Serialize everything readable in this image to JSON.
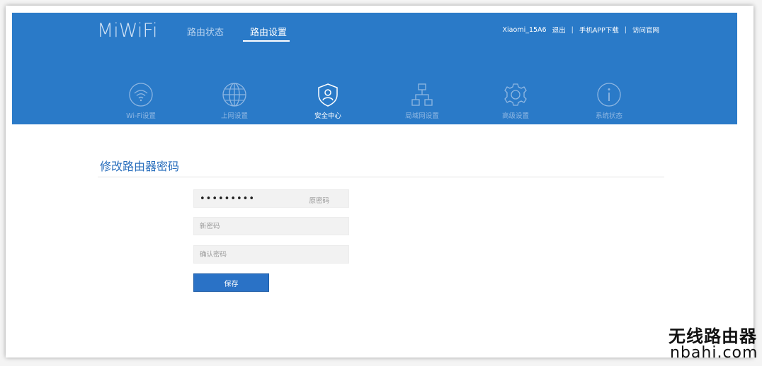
{
  "brand": {
    "logo": "MiWiFi"
  },
  "topnav": [
    {
      "label": "路由状态",
      "active": false
    },
    {
      "label": "路由设置",
      "active": true
    }
  ],
  "userbar": {
    "device": "Xiaomi_15A6",
    "logout": "退出",
    "app": "手机APP下载",
    "site": "访问官网",
    "separator": "|"
  },
  "subnav": [
    {
      "label": "Wi-Fi设置",
      "icon": "wifi-icon",
      "active": false
    },
    {
      "label": "上网设置",
      "icon": "globe-icon",
      "active": false
    },
    {
      "label": "安全中心",
      "icon": "shield-user-icon",
      "active": true
    },
    {
      "label": "局域网设置",
      "icon": "lan-icon",
      "active": false
    },
    {
      "label": "高级设置",
      "icon": "gear-icon",
      "active": false
    },
    {
      "label": "系统状态",
      "icon": "info-icon",
      "active": false
    }
  ],
  "section": {
    "title": "修改路由器密码"
  },
  "form": {
    "old_password": {
      "value": "•••••••••",
      "label": "原密码"
    },
    "new_password": {
      "placeholder": "新密码"
    },
    "confirm_password": {
      "placeholder": "确认密码"
    },
    "save_label": "保存"
  },
  "watermark": {
    "line1": "无线路由器",
    "line2": "nbahi.com"
  },
  "colors": {
    "header": "#2a7ac8",
    "accent": "#2a72c6",
    "title": "#2a6fbd"
  }
}
